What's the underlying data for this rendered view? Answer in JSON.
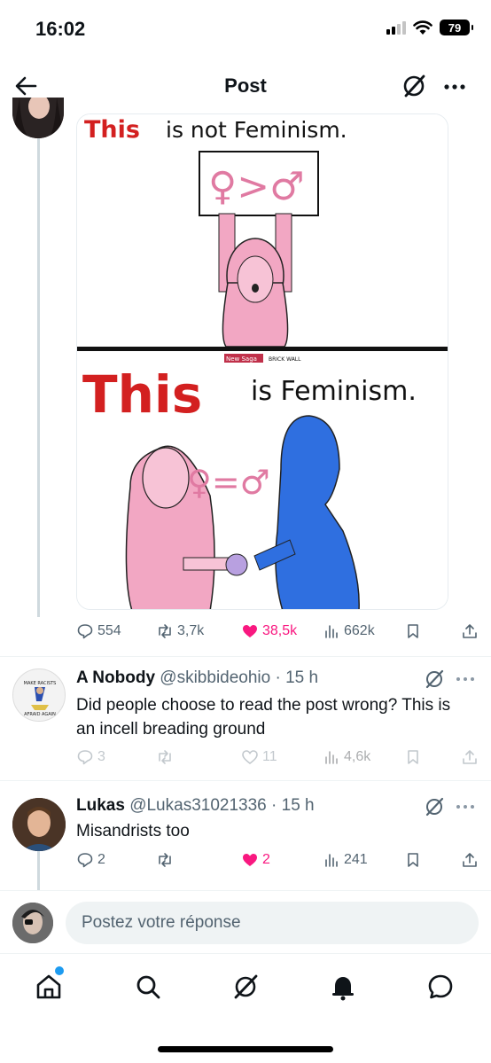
{
  "status_bar": {
    "time": "16:02",
    "battery": "79"
  },
  "header": {
    "title": "Post"
  },
  "post_image": {
    "top_heading_this": "This",
    "top_heading_rest": "is not Feminism.",
    "top_sign": "♀>♂",
    "bottom_heading_this": "This",
    "bottom_heading_rest": "is Feminism.",
    "bottom_symbol": "♀=♂",
    "watermark_left": "New Saga",
    "watermark_right": "BRICK WALL"
  },
  "post_actions": {
    "replies": "554",
    "reposts": "3,7k",
    "likes": "38,5k",
    "views": "662k"
  },
  "replies": [
    {
      "name": "A Nobody",
      "handle": "@skibbideohio",
      "time": "15 h",
      "text": "Did people choose to read the post wrong? This is an incell breading ground",
      "avatar_text_top": "MAKE RACISTS",
      "avatar_text_bottom": "AFRAID AGAIN",
      "replies": "3",
      "reposts": "",
      "likes": "11",
      "views": "4,6k"
    },
    {
      "name": "Lukas",
      "handle": "@Lukas31021336",
      "time": "15 h",
      "text": "Misandrists too",
      "replies": "2",
      "reposts": "",
      "likes": "2",
      "views": "241"
    }
  ],
  "composer": {
    "placeholder": "Postez votre réponse"
  },
  "colors": {
    "accent": "#1d9bf0",
    "like": "#f91880",
    "secondary_text": "#536471",
    "pink_figure": "#f2a7c3",
    "blue_figure": "#2f6fe0",
    "heading_red": "#d32020"
  },
  "icons": [
    "back-arrow-icon",
    "grok-icon",
    "more-icon",
    "reply-icon",
    "repost-icon",
    "like-icon",
    "views-icon",
    "bookmark-icon",
    "share-icon",
    "home-icon",
    "search-icon",
    "grok-tab-icon",
    "notifications-icon",
    "messages-icon"
  ]
}
